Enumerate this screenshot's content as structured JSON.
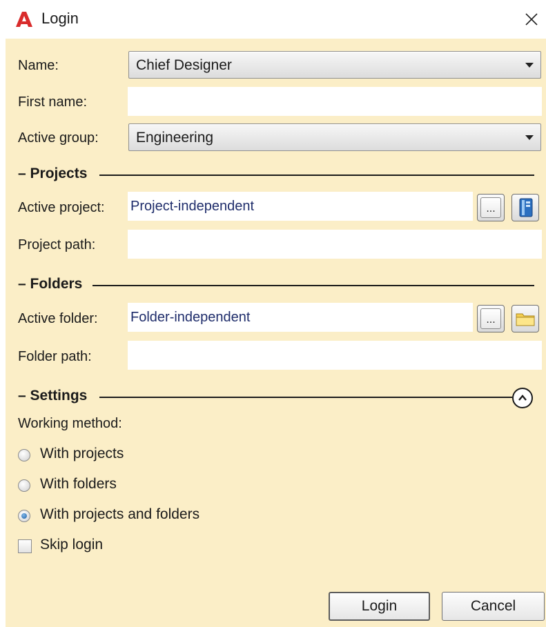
{
  "window": {
    "title": "Login",
    "app_icon": "autocad-a-icon",
    "close_glyph": "✕"
  },
  "form": {
    "name": {
      "label": "Name:",
      "value": "Chief Designer"
    },
    "first_name": {
      "label": "First name:",
      "value": ""
    },
    "active_group": {
      "label": "Active group:",
      "value": "Engineering"
    }
  },
  "projects": {
    "section_label": "– Projects",
    "active_project": {
      "label": "Active project:",
      "value": "Project-independent"
    },
    "project_path": {
      "label": "Project path:",
      "value": ""
    },
    "browse_button": "...",
    "extra_icon": "project-book-icon"
  },
  "folders": {
    "section_label": "– Folders",
    "active_folder": {
      "label": "Active folder:",
      "value": "Folder-independent"
    },
    "folder_path": {
      "label": "Folder path:",
      "value": ""
    },
    "browse_button": "...",
    "extra_icon": "folder-icon"
  },
  "settings": {
    "section_label": "– Settings",
    "working_method_label": "Working method:",
    "options": [
      {
        "label": "With projects",
        "checked": false
      },
      {
        "label": "With folders",
        "checked": false
      },
      {
        "label": "With projects and folders",
        "checked": true
      }
    ],
    "skip_login": {
      "label": "Skip login",
      "checked": false
    }
  },
  "buttons": {
    "login": "Login",
    "cancel": "Cancel"
  },
  "colors": {
    "panel_background": "#fbeec7",
    "value_text": "#1f2d6b",
    "app_icon_red": "#d92b2b"
  }
}
